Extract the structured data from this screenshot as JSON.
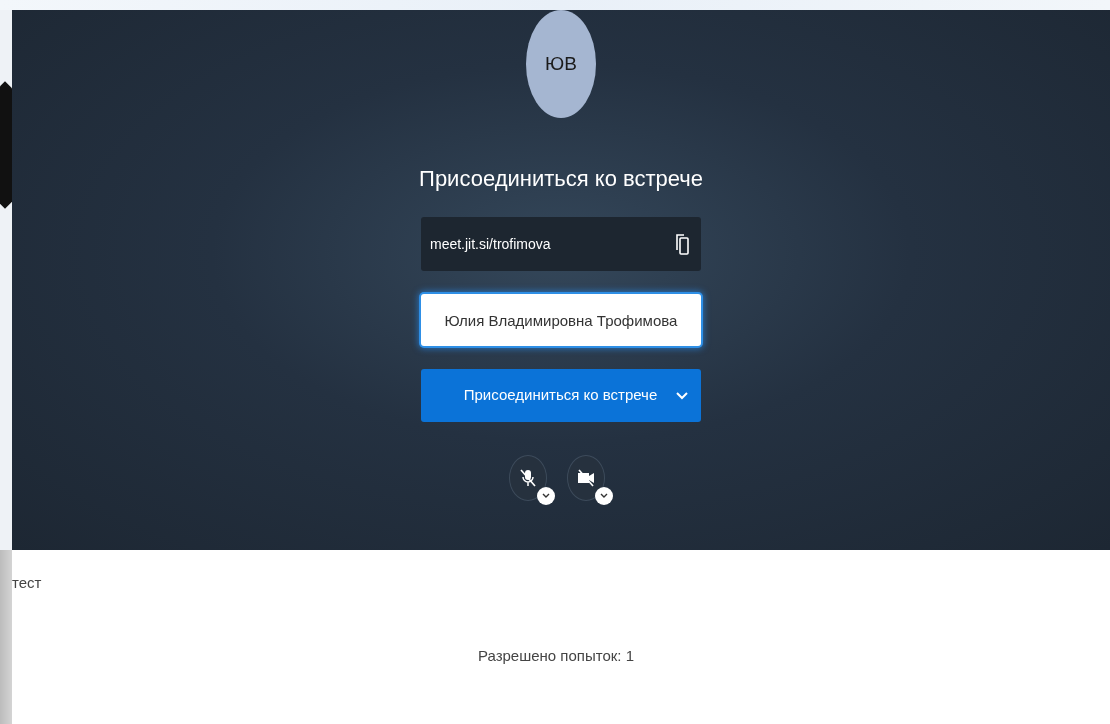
{
  "prejoin": {
    "avatar_initials": "ЮВ",
    "title": "Присоединиться ко встрече",
    "meeting_url": "meet.jit.si/trofimova",
    "name_field": {
      "value": "Юлия Владимировна Трофимова"
    },
    "join_button": {
      "label": "Присоединиться ко встрече"
    },
    "media_buttons": [
      {
        "kind": "microphone",
        "muted": true
      },
      {
        "kind": "camera",
        "muted": true
      }
    ]
  },
  "quiz": {
    "name": "тест",
    "attempts": "Разрешено попыток: 1"
  }
}
